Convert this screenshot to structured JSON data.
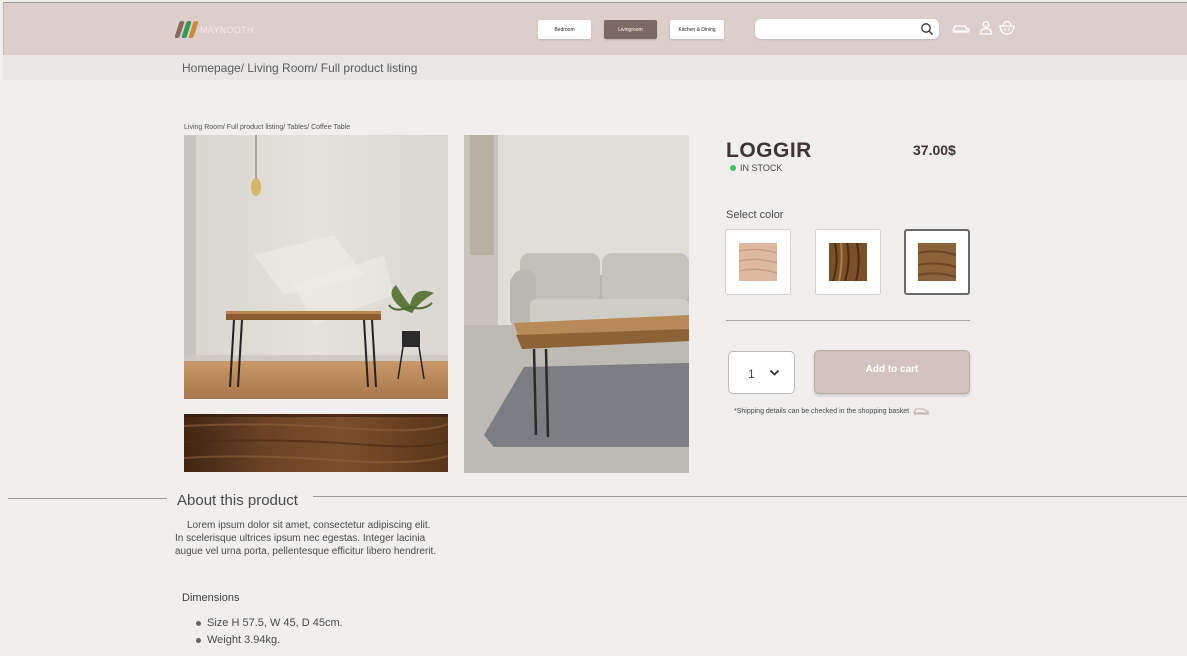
{
  "header": {
    "brand": "MAYNOOTH",
    "nav": [
      {
        "label": "Bedroom"
      },
      {
        "label": "Livingroom"
      },
      {
        "label": "Kitchen & Dining"
      }
    ],
    "search": {
      "value": "",
      "placeholder": ""
    }
  },
  "breadcrumb": "Homepage/ Living Room/ Full product listing",
  "category_path": "Living Room/ Full product listing/ Tables/ Coffee Table",
  "product": {
    "name": "LOGGIR",
    "price": "37.00$",
    "stock": "IN STOCK",
    "select_color_label": "Select color",
    "colors": [
      {
        "name": "light-wood",
        "hex": "#dfb8a0"
      },
      {
        "name": "dark-wood",
        "hex": "#7a5028"
      },
      {
        "name": "medium-wood",
        "hex": "#8c6238"
      }
    ],
    "quantity": "1",
    "add_to_cart_label": "Add to cart",
    "shipping_note": "*Shipping details can be checked in the shopping basket"
  },
  "about": {
    "title": "About this product",
    "description": "Lorem ipsum dolor sit amet, consectetur adipiscing elit. In scelerisque ultrices ipsum nec egestas. Integer lacinia augue vel urna porta, pellentesque efficitur libero hendrerit.",
    "dimensions_title": "Dimensions",
    "dimensions": [
      "Size H 57.5, W 45, D 45cm.",
      "Weight 3.94kg."
    ]
  },
  "colors": {
    "accent": "#7b6964",
    "header_bg": "#dccfcb",
    "cart_button": "#d3c3bd",
    "in_stock": "#37c95b"
  }
}
